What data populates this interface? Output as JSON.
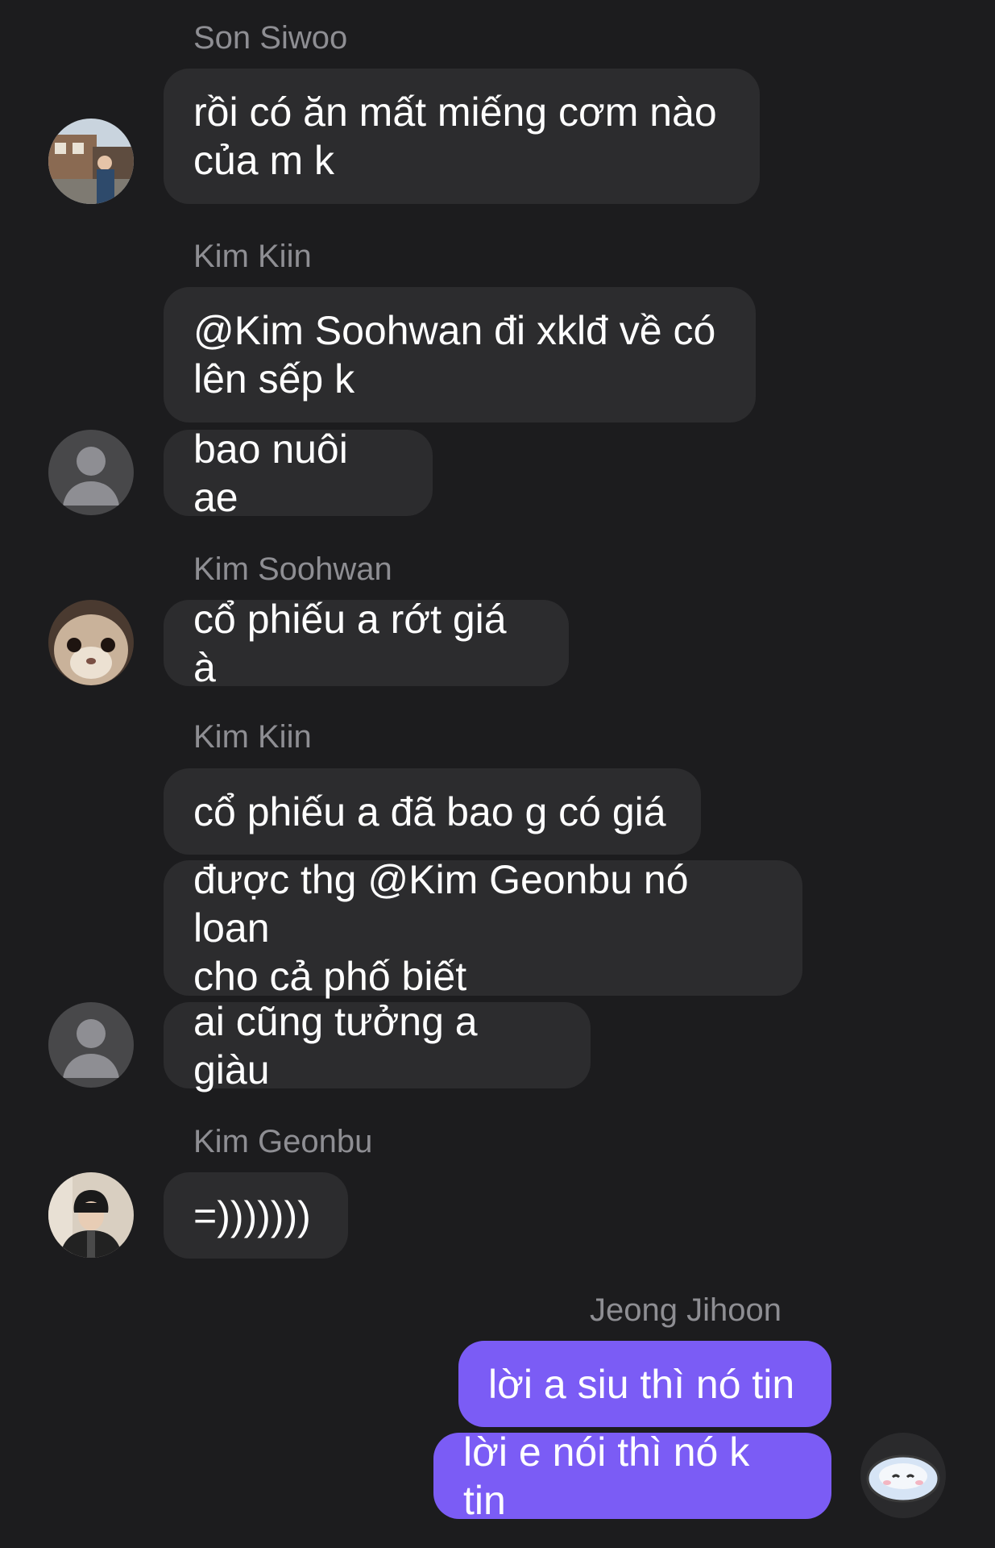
{
  "messages": [
    {
      "sender": "Son Siwoo",
      "text": "rồi có ăn mất miếng cơm nào\ncủa m k"
    },
    {
      "sender": "Kim Kiin",
      "text": "@Kim Soohwan đi xklđ về có\nlên sếp k"
    },
    {
      "text": "bao nuôi ae"
    },
    {
      "sender": "Kim Soohwan",
      "text": "cổ phiếu a rớt giá à"
    },
    {
      "sender": "Kim Kiin",
      "text": "cổ phiếu a đã bao g có giá"
    },
    {
      "text": "được thg @Kim Geonbu nó loan\ncho cả phố biết"
    },
    {
      "text": "ai cũng tưởng a giàu"
    },
    {
      "sender": "Kim Geonbu",
      "text": "=)))))))"
    },
    {
      "sender": "Jeong Jihoon",
      "text": "lời a siu thì nó tin"
    },
    {
      "text": "lời e nói thì nó k tin"
    }
  ],
  "colors": {
    "background": "#1c1c1e",
    "incoming_bubble": "#2c2c2e",
    "outgoing_bubble": "#7b5cf5",
    "sender_name": "#8e8e93"
  },
  "avatars": {
    "son_siwoo": "photo-avatar",
    "kim_kiin": "default-user-icon",
    "kim_soohwan": "cat-photo-avatar",
    "kim_geonbu": "photo-avatar",
    "jeong_jihoon": "cartoon-avatar"
  }
}
